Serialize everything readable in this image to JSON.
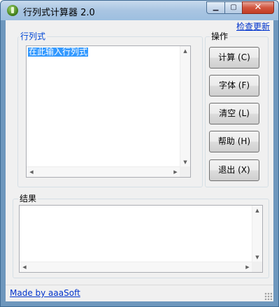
{
  "window": {
    "title": "行列式计算器 2.0"
  },
  "controls": {
    "minimize": "▁",
    "maximize": "▢",
    "close": "✕"
  },
  "header": {
    "check_update": "检查更新"
  },
  "determinant_group": {
    "label": "行列式",
    "input_value": "在此输入行列式"
  },
  "operations_group": {
    "label": "操作",
    "buttons": [
      "计算 (C)",
      "字体 (F)",
      "清空 (L)",
      "帮助 (H)",
      "退出 (X)"
    ]
  },
  "result_group": {
    "label": "结果",
    "value": ""
  },
  "status": {
    "made_by": "Made by aaaSoft"
  },
  "icons": {
    "up": "▲",
    "down": "▼",
    "left": "◀",
    "right": "▶"
  }
}
